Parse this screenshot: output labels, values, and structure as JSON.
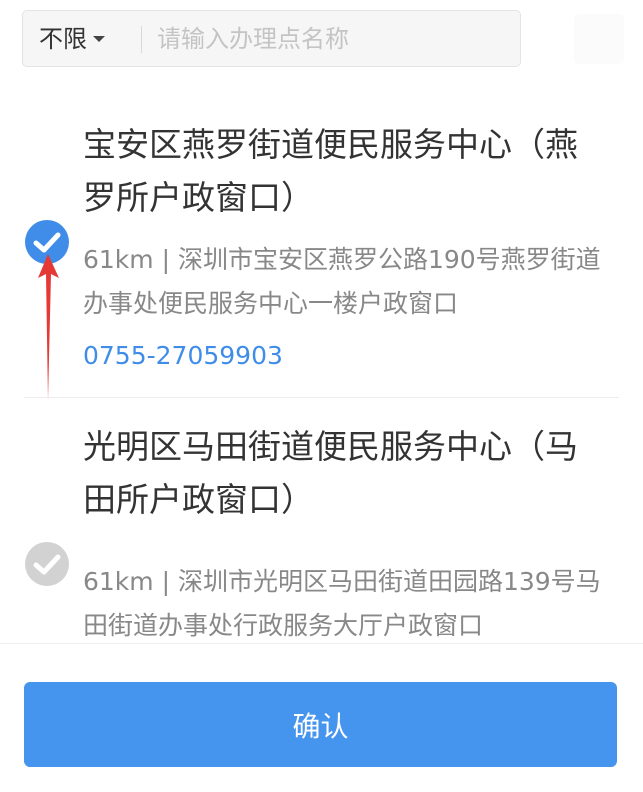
{
  "search": {
    "filter_label": "不限",
    "placeholder": "请输入办理点名称",
    "value": ""
  },
  "offices": [
    {
      "name": "宝安区燕罗街道便民服务中心（燕罗所户政窗口）",
      "address": "61km | 深圳市宝安区燕罗公路190号燕罗街道办事处便民服务中心一楼户政窗口",
      "phone": "0755-27059903",
      "selected": true
    },
    {
      "name": "光明区马田街道便民服务中心（马田所户政窗口）",
      "address": "61km | 深圳市光明区马田街道田园路139号马田街道办事处行政服务大厅户政窗口",
      "selected": false
    }
  ],
  "footer": {
    "confirm_label": "确认"
  },
  "colors": {
    "accent": "#3f8de8",
    "button": "#4594ee",
    "annotation": "#e53935",
    "unchecked": "#d2d2d2"
  }
}
